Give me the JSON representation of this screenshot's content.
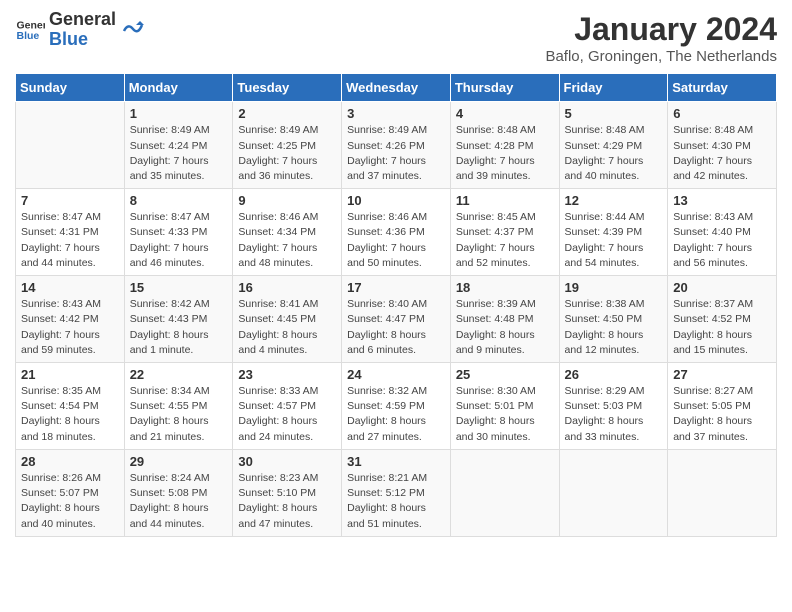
{
  "logo": {
    "line1": "General",
    "line2": "Blue"
  },
  "title": "January 2024",
  "subtitle": "Baflo, Groningen, The Netherlands",
  "days_of_week": [
    "Sunday",
    "Monday",
    "Tuesday",
    "Wednesday",
    "Thursday",
    "Friday",
    "Saturday"
  ],
  "weeks": [
    [
      {
        "date": "",
        "info": ""
      },
      {
        "date": "1",
        "info": "Sunrise: 8:49 AM\nSunset: 4:24 PM\nDaylight: 7 hours\nand 35 minutes."
      },
      {
        "date": "2",
        "info": "Sunrise: 8:49 AM\nSunset: 4:25 PM\nDaylight: 7 hours\nand 36 minutes."
      },
      {
        "date": "3",
        "info": "Sunrise: 8:49 AM\nSunset: 4:26 PM\nDaylight: 7 hours\nand 37 minutes."
      },
      {
        "date": "4",
        "info": "Sunrise: 8:48 AM\nSunset: 4:28 PM\nDaylight: 7 hours\nand 39 minutes."
      },
      {
        "date": "5",
        "info": "Sunrise: 8:48 AM\nSunset: 4:29 PM\nDaylight: 7 hours\nand 40 minutes."
      },
      {
        "date": "6",
        "info": "Sunrise: 8:48 AM\nSunset: 4:30 PM\nDaylight: 7 hours\nand 42 minutes."
      }
    ],
    [
      {
        "date": "7",
        "info": "Sunrise: 8:47 AM\nSunset: 4:31 PM\nDaylight: 7 hours\nand 44 minutes."
      },
      {
        "date": "8",
        "info": "Sunrise: 8:47 AM\nSunset: 4:33 PM\nDaylight: 7 hours\nand 46 minutes."
      },
      {
        "date": "9",
        "info": "Sunrise: 8:46 AM\nSunset: 4:34 PM\nDaylight: 7 hours\nand 48 minutes."
      },
      {
        "date": "10",
        "info": "Sunrise: 8:46 AM\nSunset: 4:36 PM\nDaylight: 7 hours\nand 50 minutes."
      },
      {
        "date": "11",
        "info": "Sunrise: 8:45 AM\nSunset: 4:37 PM\nDaylight: 7 hours\nand 52 minutes."
      },
      {
        "date": "12",
        "info": "Sunrise: 8:44 AM\nSunset: 4:39 PM\nDaylight: 7 hours\nand 54 minutes."
      },
      {
        "date": "13",
        "info": "Sunrise: 8:43 AM\nSunset: 4:40 PM\nDaylight: 7 hours\nand 56 minutes."
      }
    ],
    [
      {
        "date": "14",
        "info": "Sunrise: 8:43 AM\nSunset: 4:42 PM\nDaylight: 7 hours\nand 59 minutes."
      },
      {
        "date": "15",
        "info": "Sunrise: 8:42 AM\nSunset: 4:43 PM\nDaylight: 8 hours\nand 1 minute."
      },
      {
        "date": "16",
        "info": "Sunrise: 8:41 AM\nSunset: 4:45 PM\nDaylight: 8 hours\nand 4 minutes."
      },
      {
        "date": "17",
        "info": "Sunrise: 8:40 AM\nSunset: 4:47 PM\nDaylight: 8 hours\nand 6 minutes."
      },
      {
        "date": "18",
        "info": "Sunrise: 8:39 AM\nSunset: 4:48 PM\nDaylight: 8 hours\nand 9 minutes."
      },
      {
        "date": "19",
        "info": "Sunrise: 8:38 AM\nSunset: 4:50 PM\nDaylight: 8 hours\nand 12 minutes."
      },
      {
        "date": "20",
        "info": "Sunrise: 8:37 AM\nSunset: 4:52 PM\nDaylight: 8 hours\nand 15 minutes."
      }
    ],
    [
      {
        "date": "21",
        "info": "Sunrise: 8:35 AM\nSunset: 4:54 PM\nDaylight: 8 hours\nand 18 minutes."
      },
      {
        "date": "22",
        "info": "Sunrise: 8:34 AM\nSunset: 4:55 PM\nDaylight: 8 hours\nand 21 minutes."
      },
      {
        "date": "23",
        "info": "Sunrise: 8:33 AM\nSunset: 4:57 PM\nDaylight: 8 hours\nand 24 minutes."
      },
      {
        "date": "24",
        "info": "Sunrise: 8:32 AM\nSunset: 4:59 PM\nDaylight: 8 hours\nand 27 minutes."
      },
      {
        "date": "25",
        "info": "Sunrise: 8:30 AM\nSunset: 5:01 PM\nDaylight: 8 hours\nand 30 minutes."
      },
      {
        "date": "26",
        "info": "Sunrise: 8:29 AM\nSunset: 5:03 PM\nDaylight: 8 hours\nand 33 minutes."
      },
      {
        "date": "27",
        "info": "Sunrise: 8:27 AM\nSunset: 5:05 PM\nDaylight: 8 hours\nand 37 minutes."
      }
    ],
    [
      {
        "date": "28",
        "info": "Sunrise: 8:26 AM\nSunset: 5:07 PM\nDaylight: 8 hours\nand 40 minutes."
      },
      {
        "date": "29",
        "info": "Sunrise: 8:24 AM\nSunset: 5:08 PM\nDaylight: 8 hours\nand 44 minutes."
      },
      {
        "date": "30",
        "info": "Sunrise: 8:23 AM\nSunset: 5:10 PM\nDaylight: 8 hours\nand 47 minutes."
      },
      {
        "date": "31",
        "info": "Sunrise: 8:21 AM\nSunset: 5:12 PM\nDaylight: 8 hours\nand 51 minutes."
      },
      {
        "date": "",
        "info": ""
      },
      {
        "date": "",
        "info": ""
      },
      {
        "date": "",
        "info": ""
      }
    ]
  ]
}
